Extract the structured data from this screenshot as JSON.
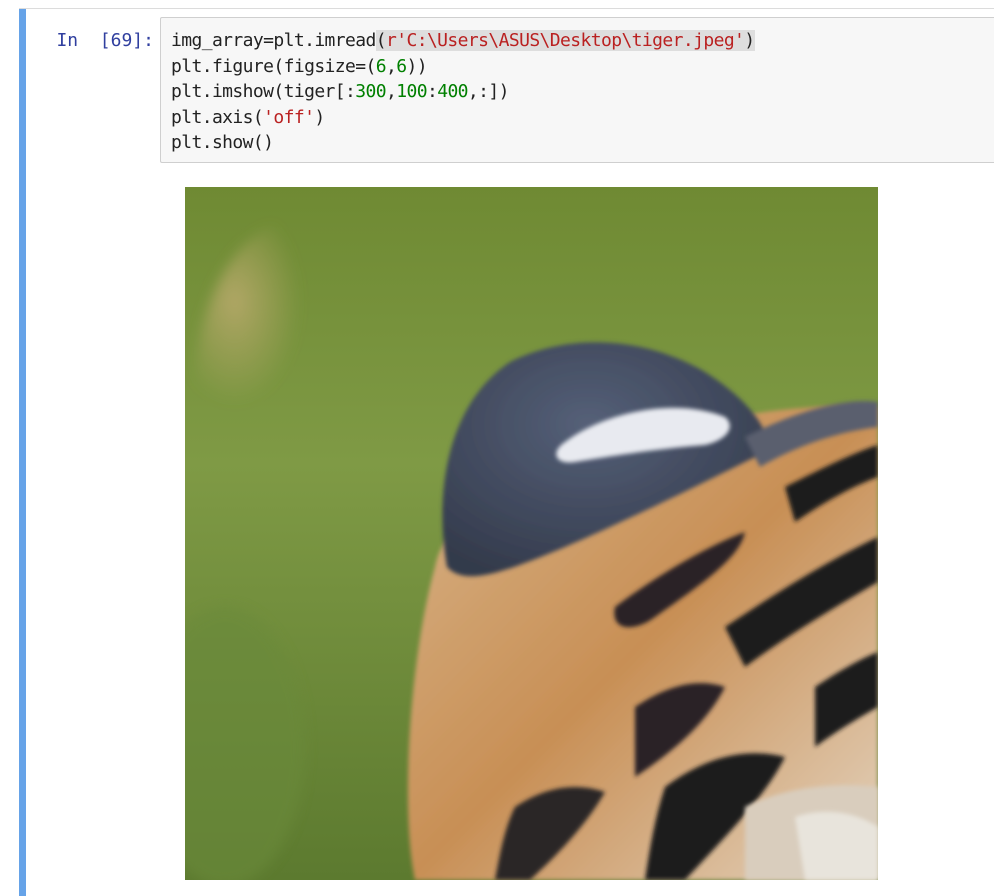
{
  "cell": {
    "prompt": "In  [69]:",
    "code_lines": [
      [
        {
          "t": "img_array=plt.imread",
          "c": ""
        },
        {
          "t": "(",
          "c": "hl"
        },
        {
          "t": "r'C:\\Users\\ASUS\\Desktop\\tiger.jpeg'",
          "c": "str hl"
        },
        {
          "t": ")",
          "c": "hl"
        }
      ],
      [
        {
          "t": "plt.figure(figsize=(",
          "c": ""
        },
        {
          "t": "6",
          "c": "num"
        },
        {
          "t": ",",
          "c": ""
        },
        {
          "t": "6",
          "c": "num"
        },
        {
          "t": "))",
          "c": ""
        }
      ],
      [
        {
          "t": "plt.imshow(tiger[:",
          "c": ""
        },
        {
          "t": "300",
          "c": "num"
        },
        {
          "t": ",",
          "c": ""
        },
        {
          "t": "100",
          "c": "num"
        },
        {
          "t": ":",
          "c": ""
        },
        {
          "t": "400",
          "c": "num"
        },
        {
          "t": ",:])",
          "c": ""
        }
      ],
      [
        {
          "t": "plt.axis(",
          "c": ""
        },
        {
          "t": "'off'",
          "c": "str"
        },
        {
          "t": ")",
          "c": ""
        }
      ],
      [
        {
          "t": "plt.show()",
          "c": ""
        }
      ]
    ]
  },
  "output": {
    "image_subject": "tiger-ear-crop",
    "colors": {
      "background_green": "#7a9a45",
      "ear_dark": "#3d4658",
      "ear_white": "#e8eaf0",
      "fur_orange": "#c9935a",
      "fur_cream": "#e6d6bf",
      "stripe_black": "#1e1c1e"
    }
  }
}
